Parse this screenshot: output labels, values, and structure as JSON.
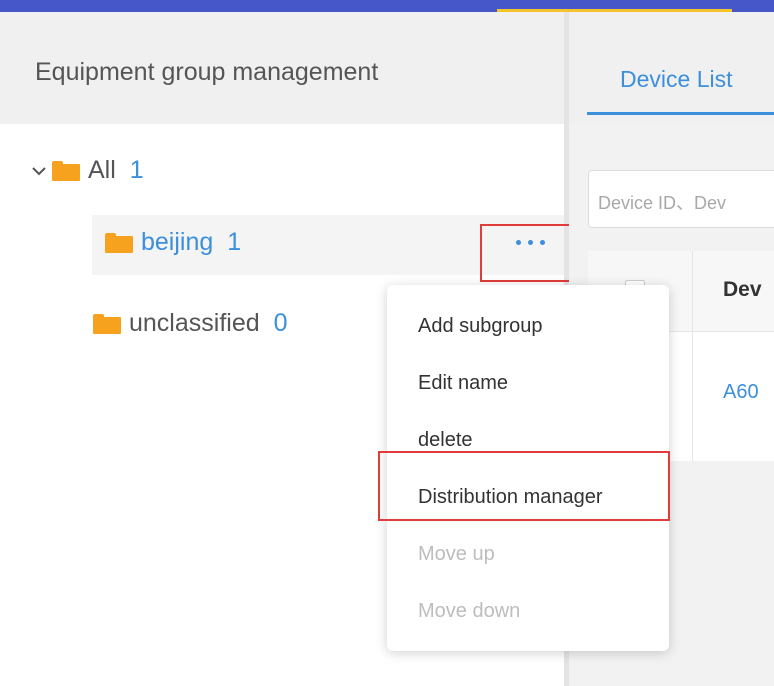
{
  "sidebar": {
    "title": "Equipment group management",
    "tree": [
      {
        "label": "All",
        "count": "1"
      },
      {
        "label": "beijing",
        "count": "1"
      },
      {
        "label": "unclassified",
        "count": "0"
      }
    ]
  },
  "tabs": {
    "device_list": "Device List"
  },
  "search": {
    "placeholder": "Device ID、Dev"
  },
  "table": {
    "header_device": "Dev",
    "row_device": "A60"
  },
  "context_menu": {
    "items": [
      {
        "label": "Add subgroup",
        "enabled": true
      },
      {
        "label": "Edit name",
        "enabled": true
      },
      {
        "label": "delete",
        "enabled": true
      },
      {
        "label": "Distribution manager",
        "enabled": true
      },
      {
        "label": "Move up",
        "enabled": false
      },
      {
        "label": "Move down",
        "enabled": false
      }
    ]
  },
  "colors": {
    "accent_bar": "#4658c9",
    "accent_highlight": "#f5c42b",
    "link_blue": "#3b8fdb",
    "folder_orange": "#f7a21e",
    "highlight_red": "#e03c3c"
  },
  "icons": {
    "expand": "chevron-down-icon",
    "folder": "folder-icon",
    "more": "more-horizontal-icon"
  }
}
